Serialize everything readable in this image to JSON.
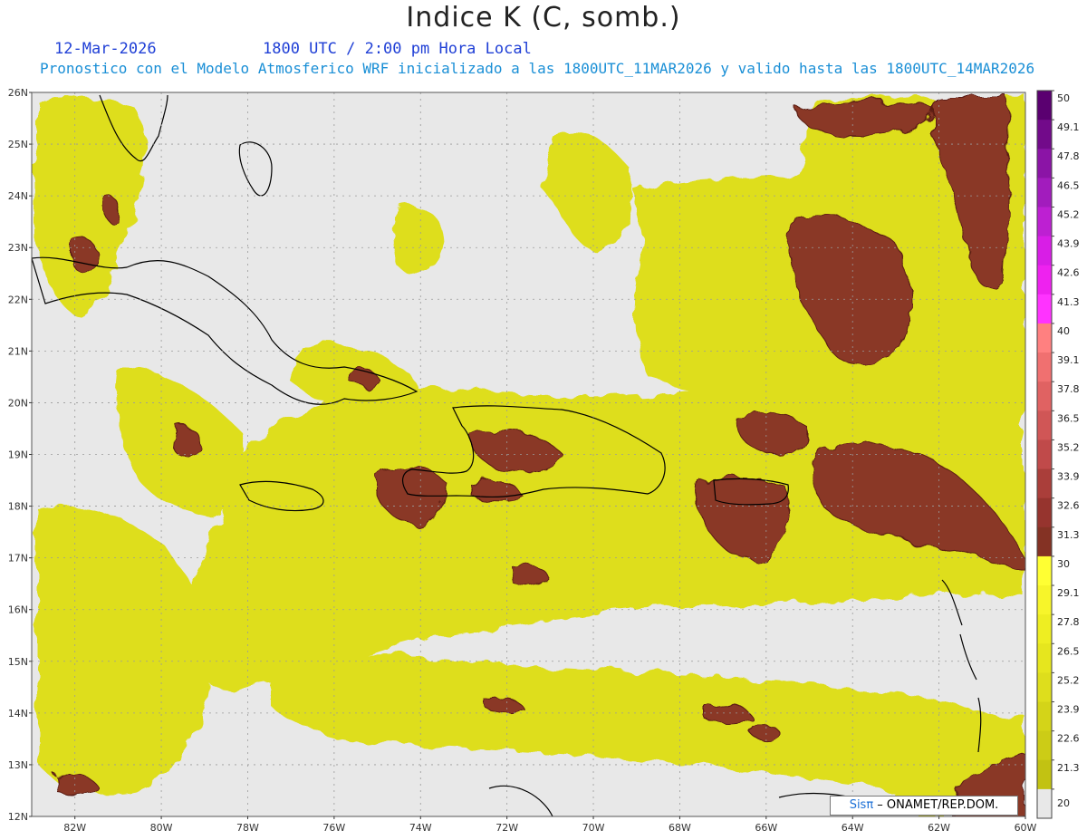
{
  "header": {
    "title": "Indice K (C, somb.)",
    "date": "12-Mar-2026",
    "time": "1800 UTC / 2:00 pm Hora Local",
    "forecast_line": "Pronostico con el Modelo Atmosferico WRF inicializado a las 1800UTC_11MAR2026 y valido hasta las  1800UTC_14MAR2026"
  },
  "map": {
    "lon_range": [
      -83,
      -60
    ],
    "lat_range": [
      12,
      26
    ],
    "lat_labels": [
      "26N",
      "25N",
      "24N",
      "23N",
      "22N",
      "21N",
      "20N",
      "19N",
      "18N",
      "17N",
      "16N",
      "15N",
      "14N",
      "13N",
      "12N"
    ],
    "lon_labels": [
      "82W",
      "80W",
      "78W",
      "76W",
      "74W",
      "72W",
      "70W",
      "68W",
      "66W",
      "64W",
      "62W",
      "60W"
    ],
    "background_color": "#e8e8e8",
    "coastline_color": "#000000"
  },
  "colorbar": {
    "labels": [
      "50",
      "49.1",
      "47.8",
      "46.5",
      "45.2",
      "43.9",
      "42.6",
      "41.3",
      "40",
      "39.1",
      "37.8",
      "36.5",
      "35.2",
      "33.9",
      "32.6",
      "31.3",
      "30",
      "29.1",
      "27.8",
      "26.5",
      "25.2",
      "23.9",
      "22.6",
      "21.3",
      "20"
    ],
    "colors": [
      "#5a0070",
      "#720a8a",
      "#8b14a6",
      "#a21cbd",
      "#bd20d2",
      "#d81ee6",
      "#ee22ef",
      "#ff33ff",
      "#ff8080",
      "#f07070",
      "#e06262",
      "#d05656",
      "#c04a4a",
      "#aa3e3a",
      "#96342e",
      "#843224",
      "#ffff33",
      "#f7f52a",
      "#eeee22",
      "#e6e61e",
      "#dede1c",
      "#d4d418",
      "#cccc16",
      "#c2c212",
      "#e8e8e8"
    ]
  },
  "credit": {
    "sis": "Sisπ",
    "text": " – ONAMET/REP.DOM."
  }
}
